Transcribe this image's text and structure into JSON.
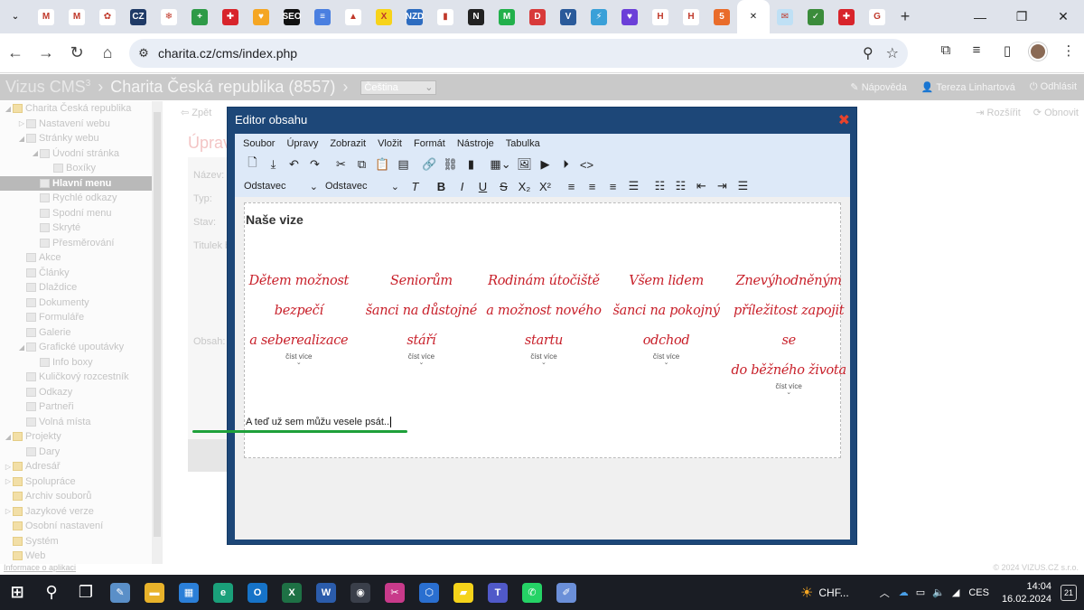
{
  "browser": {
    "tabs": [
      {
        "icon": "chevron-down-icon",
        "color": "#dfe3eb",
        "glyph": "⌄"
      },
      {
        "icon": "gmail-icon",
        "color": "#ffffff",
        "glyph": "M"
      },
      {
        "icon": "gmail-icon",
        "color": "#ffffff",
        "glyph": "M"
      },
      {
        "icon": "flower-icon",
        "color": "#ffffff",
        "glyph": "✿"
      },
      {
        "icon": "cz-icon",
        "color": "#1f3a66",
        "glyph": "CZ"
      },
      {
        "icon": "snowflake-icon",
        "color": "#ffffff",
        "glyph": "❄"
      },
      {
        "icon": "plus-square-icon",
        "color": "#2e9a47",
        "glyph": "+"
      },
      {
        "icon": "cross-icon",
        "color": "#d8242b",
        "glyph": "✚"
      },
      {
        "icon": "shield-icon",
        "color": "#f5a623",
        "glyph": "♥"
      },
      {
        "icon": "seo-icon",
        "color": "#111111",
        "glyph": "SEO"
      },
      {
        "icon": "docs-icon",
        "color": "#4a7fe0",
        "glyph": "≡"
      },
      {
        "icon": "drive-icon",
        "color": "#ffffff",
        "glyph": "▲"
      },
      {
        "icon": "x-icon",
        "color": "#f7d31a",
        "glyph": "X"
      },
      {
        "icon": "nzd-icon",
        "color": "#2d6cc0",
        "glyph": "NZD"
      },
      {
        "icon": "analytics-icon",
        "color": "#ffffff",
        "glyph": "▮"
      },
      {
        "icon": "notion-icon",
        "color": "#222222",
        "glyph": "N"
      },
      {
        "icon": "m-icon",
        "color": "#22b04b",
        "glyph": "M"
      },
      {
        "icon": "d-icon",
        "color": "#d83a3a",
        "glyph": "D"
      },
      {
        "icon": "v-icon",
        "color": "#2a5a9a",
        "glyph": "V"
      },
      {
        "icon": "lightning-icon",
        "color": "#3aa0d8",
        "glyph": "⚡"
      },
      {
        "icon": "chat-icon",
        "color": "#6b3fd8",
        "glyph": "♥"
      },
      {
        "icon": "h-icon",
        "color": "#ffffff",
        "glyph": "H"
      },
      {
        "icon": "h-icon",
        "color": "#ffffff",
        "glyph": "H"
      },
      {
        "icon": "html5-icon",
        "color": "#e96c2a",
        "glyph": "5"
      },
      {
        "icon": "close-icon",
        "color": "#ffffff",
        "glyph": "✕",
        "active": true
      },
      {
        "icon": "mail-icon",
        "color": "#bfe0f5",
        "glyph": "✉"
      },
      {
        "icon": "check-icon",
        "color": "#3b8c3b",
        "glyph": "✓"
      },
      {
        "icon": "cross-icon",
        "color": "#d8242b",
        "glyph": "✚"
      },
      {
        "icon": "google-icon",
        "color": "#ffffff",
        "glyph": "G"
      }
    ],
    "url": "charita.cz/cms/index.php"
  },
  "cms": {
    "brand": "Vizus CMS",
    "brand_sup": "3",
    "site": "Charita Česká republika (8557)",
    "language": "Čeština",
    "help": "Nápověda",
    "user": "Tereza Linhartová",
    "logout": "Odhlásit"
  },
  "tree": [
    {
      "label": "Charita Česká republika",
      "indent": 0,
      "tog": "◢",
      "folder": true
    },
    {
      "label": "Nastavení webu",
      "indent": 1,
      "tog": "▷"
    },
    {
      "label": "Stránky webu",
      "indent": 1,
      "tog": "◢"
    },
    {
      "label": "Úvodní stránka",
      "indent": 2,
      "tog": "◢"
    },
    {
      "label": "Boxíky",
      "indent": 3,
      "tog": ""
    },
    {
      "label": "Hlavní menu",
      "indent": 2,
      "tog": "",
      "selected": true
    },
    {
      "label": "Rychlé odkazy",
      "indent": 2,
      "tog": ""
    },
    {
      "label": "Spodní menu",
      "indent": 2,
      "tog": ""
    },
    {
      "label": "Skryté",
      "indent": 2,
      "tog": ""
    },
    {
      "label": "Přesměrování",
      "indent": 2,
      "tog": ""
    },
    {
      "label": "Akce",
      "indent": 1,
      "tog": ""
    },
    {
      "label": "Články",
      "indent": 1,
      "tog": ""
    },
    {
      "label": "Dlaždice",
      "indent": 1,
      "tog": ""
    },
    {
      "label": "Dokumenty",
      "indent": 1,
      "tog": ""
    },
    {
      "label": "Formuláře",
      "indent": 1,
      "tog": ""
    },
    {
      "label": "Galerie",
      "indent": 1,
      "tog": ""
    },
    {
      "label": "Grafické upoutávky",
      "indent": 1,
      "tog": "◢"
    },
    {
      "label": "Info boxy",
      "indent": 2,
      "tog": ""
    },
    {
      "label": "Kuličkový rozcestník",
      "indent": 1,
      "tog": ""
    },
    {
      "label": "Odkazy",
      "indent": 1,
      "tog": ""
    },
    {
      "label": "Partneři",
      "indent": 1,
      "tog": ""
    },
    {
      "label": "Volná místa",
      "indent": 1,
      "tog": ""
    },
    {
      "label": "Projekty",
      "indent": 0,
      "tog": "◢",
      "folder": true
    },
    {
      "label": "Dary",
      "indent": 1,
      "tog": ""
    },
    {
      "label": "Adresář",
      "indent": 0,
      "tog": "▷",
      "folder": true
    },
    {
      "label": "Spolupráce",
      "indent": 0,
      "tog": "▷",
      "folder": true
    },
    {
      "label": "Archiv souborů",
      "indent": 0,
      "tog": "",
      "folder": true
    },
    {
      "label": "Jazykové verze",
      "indent": 0,
      "tog": "▷",
      "folder": true
    },
    {
      "label": "Osobní nastavení",
      "indent": 0,
      "tog": "",
      "folder": true
    },
    {
      "label": "Systém",
      "indent": 0,
      "tog": "",
      "folder": true
    },
    {
      "label": "Web",
      "indent": 0,
      "tog": "",
      "folder": true
    }
  ],
  "footer": {
    "info_link": "Informace o aplikaci",
    "copyright": "© 2024 VIZUS.CZ s.r.o."
  },
  "form": {
    "back": "Zpět",
    "title": "Úprav",
    "fields": [
      "Název:",
      "Typ:",
      "Stav:",
      "Titulek b",
      "Obsah:"
    ],
    "refresh": "Obnovit",
    "collapse": "Rozšířit"
  },
  "modal": {
    "title": "Editor obsahu",
    "menu": [
      "Soubor",
      "Úpravy",
      "Zobrazit",
      "Vložit",
      "Formát",
      "Nástroje",
      "Tabulka"
    ],
    "block_format": "Odstavec",
    "font_format": "Odstavec",
    "heading": "Naše vize",
    "cards": [
      {
        "lines": [
          "Dětem možnost",
          "bezpečí",
          "a seberealizace"
        ],
        "more": "číst více"
      },
      {
        "lines": [
          "Seniorům",
          "šanci na důstojné",
          "stáří"
        ],
        "more": "číst více"
      },
      {
        "lines": [
          "Rodinám útočiště",
          "a možnost nového",
          "startu"
        ],
        "more": "číst více"
      },
      {
        "lines": [
          "Všem lidem",
          "šanci na pokojný",
          "odchod"
        ],
        "more": "číst více"
      },
      {
        "lines": [
          "Znevýhodněným",
          "příležitost zapojit se",
          "do běžného života"
        ],
        "more": "číst více"
      }
    ],
    "typed_text": "A teď už sem můžu vesele psát.."
  },
  "taskbar": {
    "apps": [
      {
        "name": "start-icon",
        "color": "#1a1d24",
        "glyph": "⊞"
      },
      {
        "name": "search-icon",
        "color": "#1a1d24",
        "glyph": "⚲"
      },
      {
        "name": "task-view-icon",
        "color": "#1a1d24",
        "glyph": "❐"
      },
      {
        "name": "notes-icon",
        "color": "#5a8fc8",
        "glyph": "✎"
      },
      {
        "name": "file-explorer-icon",
        "color": "#e8b22a",
        "glyph": "▬"
      },
      {
        "name": "store-icon",
        "color": "#2b7fd8",
        "glyph": "▦"
      },
      {
        "name": "edge-icon",
        "color": "#1aa07a",
        "glyph": "e"
      },
      {
        "name": "outlook-icon",
        "color": "#1673c8",
        "glyph": "O"
      },
      {
        "name": "excel-icon",
        "color": "#1e7145",
        "glyph": "X"
      },
      {
        "name": "word-icon",
        "color": "#2b5cab",
        "glyph": "W"
      },
      {
        "name": "chrome-icon",
        "color": "#3a3f4a",
        "glyph": "◉"
      },
      {
        "name": "snip-icon",
        "color": "#c83a8a",
        "glyph": "✂"
      },
      {
        "name": "vpn-icon",
        "color": "#2a6fd0",
        "glyph": "⬡"
      },
      {
        "name": "sticky-notes-icon",
        "color": "#f5d31a",
        "glyph": "▰"
      },
      {
        "name": "teams-icon",
        "color": "#5059c9",
        "glyph": "T"
      },
      {
        "name": "whatsapp-icon",
        "color": "#25d366",
        "glyph": "✆"
      },
      {
        "name": "paint-icon",
        "color": "#6b8fd8",
        "glyph": "✐"
      }
    ],
    "weather": "CHF...",
    "lang": "CES",
    "time": "14:04",
    "date": "16.02.2024",
    "notifications": "21"
  }
}
